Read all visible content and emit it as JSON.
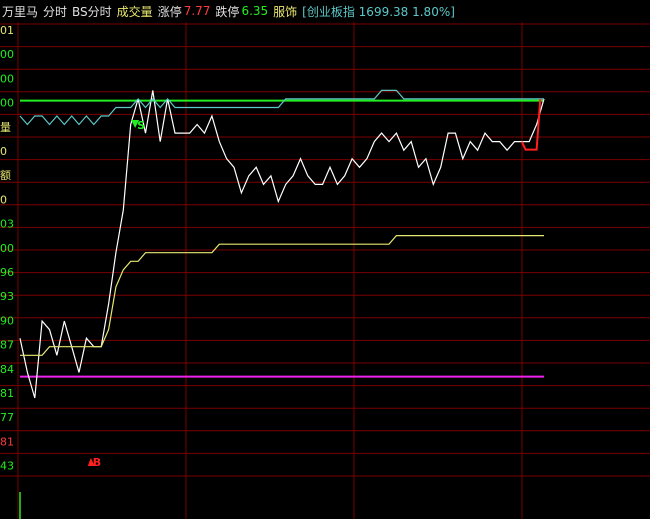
{
  "header": {
    "name": "万里马",
    "tab_fenshi": "分时",
    "tab_bs": "BS分时",
    "volume_label": "成交量",
    "limit_up_label": "涨停",
    "limit_up_value": "7.77",
    "limit_down_label": "跌停",
    "limit_down_value": "6.35",
    "sector": "服饰",
    "index_info": "[创业板指 1699.38 1.80%]"
  },
  "colors": {
    "background": "#000000",
    "grid": "#7a0000",
    "price_line": "#ffffff",
    "avg_line": "#e8e870",
    "index_line": "#5cc8c8",
    "green_level": "#22ee22",
    "magenta_level": "#ee22ee",
    "red_segment": "#ff2020",
    "up_text": "#ff3c3c",
    "down_text": "#22ee22",
    "yellow_text": "#e8e870",
    "cyan_text": "#5cc8c8"
  },
  "left_axis_labels": [
    "01",
    "00",
    "00",
    "00",
    "量",
    "0",
    "额",
    "0",
    "03",
    "00",
    "96",
    "93",
    "90",
    "87",
    "84",
    "81",
    "77",
    "81",
    "43"
  ],
  "markers": [
    {
      "label": "S",
      "color": "#22ee22",
      "shape": "triangle-down"
    },
    {
      "label": "B",
      "color": "#ff2020",
      "shape": "triangle-up"
    }
  ],
  "chart_data": {
    "type": "line",
    "levels": {
      "green": 7.158,
      "magenta": 6.835
    },
    "series": [
      {
        "values": [
          6.88,
          6.84,
          6.81,
          6.9,
          6.89,
          6.86,
          6.9,
          6.87,
          6.84,
          6.88,
          6.87,
          6.87,
          6.92,
          6.98,
          7.03,
          7.13,
          7.16,
          7.12,
          7.17,
          7.11,
          7.16,
          7.12,
          7.12,
          7.12,
          7.13,
          7.12,
          7.14,
          7.11,
          7.09,
          7.08,
          7.05,
          7.07,
          7.08,
          7.06,
          7.07,
          7.04,
          7.06,
          7.07,
          7.09,
          7.07,
          7.06,
          7.06,
          7.08,
          7.06,
          7.07,
          7.09,
          7.08,
          7.09,
          7.11,
          7.12,
          7.11,
          7.12,
          7.1,
          7.11,
          7.08,
          7.09,
          7.06,
          7.08,
          7.12,
          7.12,
          7.09,
          7.11,
          7.1,
          7.12,
          7.11,
          7.11,
          7.1,
          7.11,
          7.11,
          7.11,
          7.13,
          7.16
        ]
      },
      {
        "values": [
          6.86,
          6.86,
          6.86,
          6.86,
          6.87,
          6.87,
          6.87,
          6.87,
          6.87,
          6.87,
          6.87,
          6.87,
          6.89,
          6.94,
          6.96,
          6.97,
          6.97,
          6.98,
          6.98,
          6.98,
          6.98,
          6.98,
          6.98,
          6.98,
          6.98,
          6.98,
          6.98,
          6.99,
          6.99,
          6.99,
          6.99,
          6.99,
          6.99,
          6.99,
          6.99,
          6.99,
          6.99,
          6.99,
          6.99,
          6.99,
          6.99,
          6.99,
          6.99,
          6.99,
          6.99,
          6.99,
          6.99,
          6.99,
          6.99,
          6.99,
          6.99,
          7.0,
          7.0,
          7.0,
          7.0,
          7.0,
          7.0,
          7.0,
          7.0,
          7.0,
          7.0,
          7.0,
          7.0,
          7.0,
          7.0,
          7.0,
          7.0,
          7.0,
          7.0,
          7.0,
          7.0,
          7.0
        ]
      },
      {
        "values": [
          7.14,
          7.13,
          7.14,
          7.14,
          7.13,
          7.14,
          7.13,
          7.14,
          7.13,
          7.14,
          7.13,
          7.14,
          7.14,
          7.15,
          7.15,
          7.15,
          7.16,
          7.15,
          7.16,
          7.15,
          7.16,
          7.15,
          7.15,
          7.15,
          7.15,
          7.15,
          7.15,
          7.15,
          7.15,
          7.15,
          7.15,
          7.15,
          7.15,
          7.15,
          7.15,
          7.15,
          7.16,
          7.16,
          7.16,
          7.16,
          7.16,
          7.16,
          7.16,
          7.16,
          7.16,
          7.16,
          7.16,
          7.16,
          7.16,
          7.17,
          7.17,
          7.17,
          7.16,
          7.16,
          7.16,
          7.16,
          7.16,
          7.16,
          7.16,
          7.16,
          7.16,
          7.16,
          7.16,
          7.16,
          7.16,
          7.16,
          7.16,
          7.16,
          7.16,
          7.16,
          7.16,
          7.16
        ]
      }
    ],
    "ylim": [
      6.7,
      7.25
    ],
    "grid": true
  }
}
